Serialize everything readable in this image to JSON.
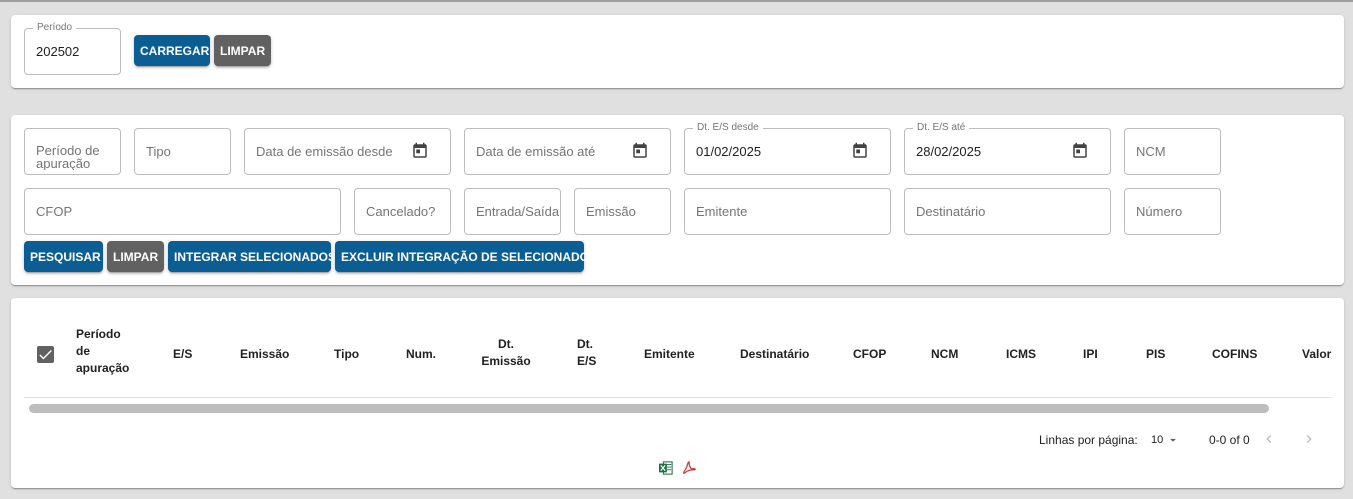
{
  "load_panel": {
    "period_label": "Período",
    "period_value": "202502",
    "load_button": "CARREGAR",
    "clear_button": "LIMPAR"
  },
  "filters": {
    "row1": {
      "apuracao_placeholder": "Período de apuração",
      "tipo_placeholder": "Tipo",
      "emissao_desde_placeholder": "Data de emissão desde",
      "emissao_ate_placeholder": "Data de emissão até",
      "es_desde_label": "Dt. E/S desde",
      "es_desde_value": "01/02/2025",
      "es_ate_label": "Dt. E/S até",
      "es_ate_value": "28/02/2025",
      "ncm_placeholder": "NCM"
    },
    "row2": {
      "cfop_placeholder": "CFOP",
      "cancelado_placeholder": "Cancelado?",
      "entrada_saida_placeholder": "Entrada/Saída",
      "emissao_placeholder": "Emissão",
      "emitente_placeholder": "Emitente",
      "destinatario_placeholder": "Destinatário",
      "numero_placeholder": "Número"
    },
    "buttons": {
      "search": "PESQUISAR",
      "clear": "LIMPAR",
      "integrate": "INTEGRAR SELECIONADOS",
      "exclude": "EXCLUIR INTEGRAÇÃO DE SELECIONADOS"
    }
  },
  "table": {
    "select_all_checked": true,
    "headers": {
      "apuracao_l1": "Período",
      "apuracao_l2": "de",
      "apuracao_l3": "apuração",
      "es": "E/S",
      "emissao": "Emissão",
      "tipo": "Tipo",
      "num": "Num.",
      "dt_emissao_l1": "Dt.",
      "dt_emissao_l2": "Emissão",
      "dt_es_l1": "Dt.",
      "dt_es_l2": "E/S",
      "emitente": "Emitente",
      "destinatario": "Destinatário",
      "cfop": "CFOP",
      "ncm": "NCM",
      "icms": "ICMS",
      "ipi": "IPI",
      "pis": "PIS",
      "cofins": "COFINS",
      "valor": "Valor"
    },
    "rows": []
  },
  "pagination": {
    "rows_per_page_label": "Linhas por página:",
    "rows_per_page_value": "10",
    "range_text": "0-0 of 0"
  },
  "colors": {
    "primary": "#0b5e94",
    "secondary": "#616161",
    "excel": "#1d7044",
    "pdf": "#d32f2f"
  }
}
